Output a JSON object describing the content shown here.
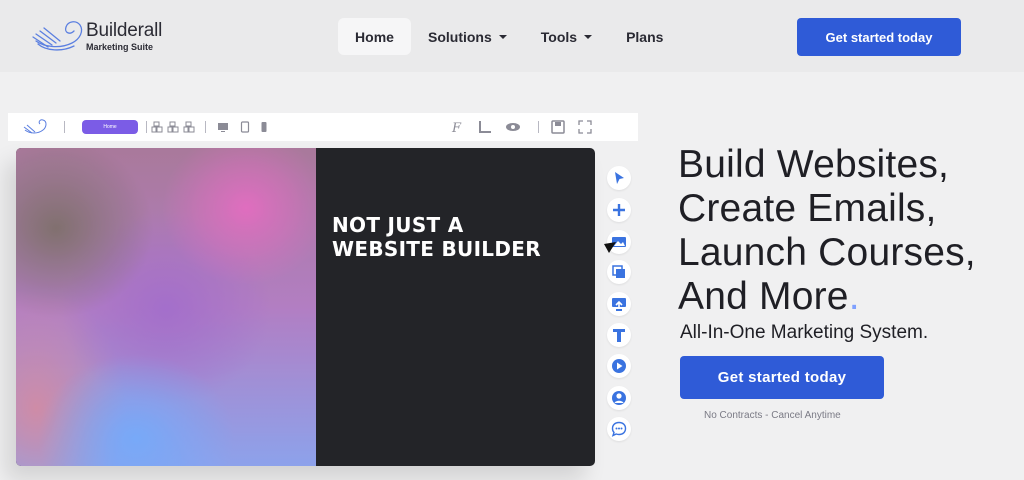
{
  "logo": {
    "name": "Builderall",
    "subtitle": "Marketing Suite",
    "icon": "whale-logo-icon"
  },
  "nav": {
    "items": [
      {
        "label": "Home",
        "active": true
      },
      {
        "label": "Solutions",
        "dropdown": true
      },
      {
        "label": "Tools",
        "dropdown": true
      },
      {
        "label": "Plans"
      }
    ],
    "cta_label": "Get started today"
  },
  "editor": {
    "toolbar": {
      "page_pill": "Home",
      "icons": [
        "builderall-mini-logo-icon",
        "layout-icon-1",
        "layout-icon-2",
        "layout-icon-3",
        "desktop-icon",
        "tablet-icon",
        "mobile-icon",
        "font-icon",
        "ruler-icon",
        "eye-icon",
        "save-icon",
        "fullscreen-icon"
      ]
    },
    "canvas_text": [
      "NOT JUST A",
      "WEBSITE BUILDER"
    ],
    "side_tools": [
      "pointer-icon",
      "plus-icon",
      "image-icon",
      "copy-icon",
      "upload-icon",
      "text-icon",
      "play-icon",
      "user-icon",
      "chat-icon"
    ]
  },
  "hero": {
    "headline_lines": [
      "Build Websites,",
      "Create Emails,",
      "Launch Courses,",
      "And More"
    ],
    "headline_dot": ".",
    "subhead": "All-In-One Marketing System.",
    "cta_label": "Get started today",
    "fineprint": "No Contracts - Cancel Anytime"
  },
  "colors": {
    "accent": "#2f5bd7",
    "editor_pill": "#7b5ce6",
    "tool_icon": "#3a73e0",
    "dot": "#7fa0ff"
  }
}
